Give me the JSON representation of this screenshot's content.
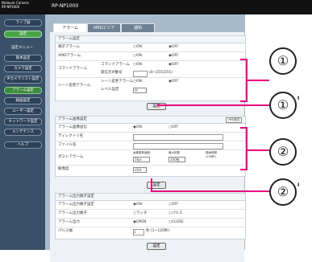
{
  "header": {
    "brand": "Network Camera\nRP-NP1000",
    "model": "RP-NP1000"
  },
  "sidebar": {
    "items": [
      {
        "label": "ライブ画"
      },
      {
        "label": "設定"
      },
      {
        "label": "設定メニュー"
      },
      {
        "label": "基本設定"
      },
      {
        "label": "カメラ設定"
      },
      {
        "label": "IPカメラリスト設定"
      },
      {
        "label": "アラーム設定"
      },
      {
        "label": "録画設定"
      },
      {
        "label": "ユーザー設定"
      },
      {
        "label": "ネットワーク設定"
      },
      {
        "label": "メンテナンス"
      },
      {
        "label": "ヘルプ"
      }
    ]
  },
  "tabs": [
    {
      "label": "アラーム"
    },
    {
      "label": "VMDエリア"
    },
    {
      "label": "通知"
    }
  ],
  "section1": {
    "title": "アラーム設定",
    "rows": [
      {
        "label": "端子アラーム",
        "on": "ON",
        "off": "OFF"
      },
      {
        "label": "VMDアラーム",
        "on": "ON",
        "off": "OFF"
      },
      {
        "label": "コマンドアラーム",
        "sub1": "コマンドアラーム",
        "on": "ON",
        "off": "OFF",
        "sub2": "発信元IP番号",
        "sub2_value": "(0~255/255)"
      },
      {
        "label": "シーン変更アラーム",
        "sub1": "シーン変更アラーム",
        "on": "ON",
        "off": "OFF",
        "sub2": "レベル設定",
        "sub2_value": "中"
      }
    ],
    "button": "設定"
  },
  "section2": {
    "title": "アラーム画像設定",
    "mini": "VMD設定",
    "rows": [
      {
        "label": "アラーム画像送信",
        "on": "ON",
        "off": "OFF"
      },
      {
        "label": "ディレクトリ名"
      },
      {
        "label": "ファイル名"
      },
      {
        "label": "ポストアラーム",
        "col1": "画像更新速度",
        "col1_value": "1fps",
        "col2": "最大枚数",
        "col2_value": "100枚",
        "col3": "録画時間",
        "col3_value": "(100秒)"
      },
      {
        "label": "解像度",
        "value": "VGA"
      }
    ],
    "button": "設定"
  },
  "section3": {
    "title": "アラーム出力端子設定",
    "rows": [
      {
        "label": "アラーム出力端子設定",
        "on": "ON",
        "off": "OFF"
      },
      {
        "label": "アラーム出力端子",
        "opt1": "ラッチ",
        "opt2": "パルス"
      },
      {
        "label": "アラーム出力",
        "opt1": "OPEN",
        "opt2": "CLOSE"
      },
      {
        "label": "パルス幅",
        "value": "1",
        "unit": "秒 (1~120秒)"
      }
    ],
    "button": "設定"
  },
  "callouts": [
    {
      "label": "①",
      "suffix": ""
    },
    {
      "label": "①",
      "suffix": "'"
    },
    {
      "label": "②",
      "suffix": ""
    },
    {
      "label": "②",
      "suffix": "'"
    }
  ]
}
